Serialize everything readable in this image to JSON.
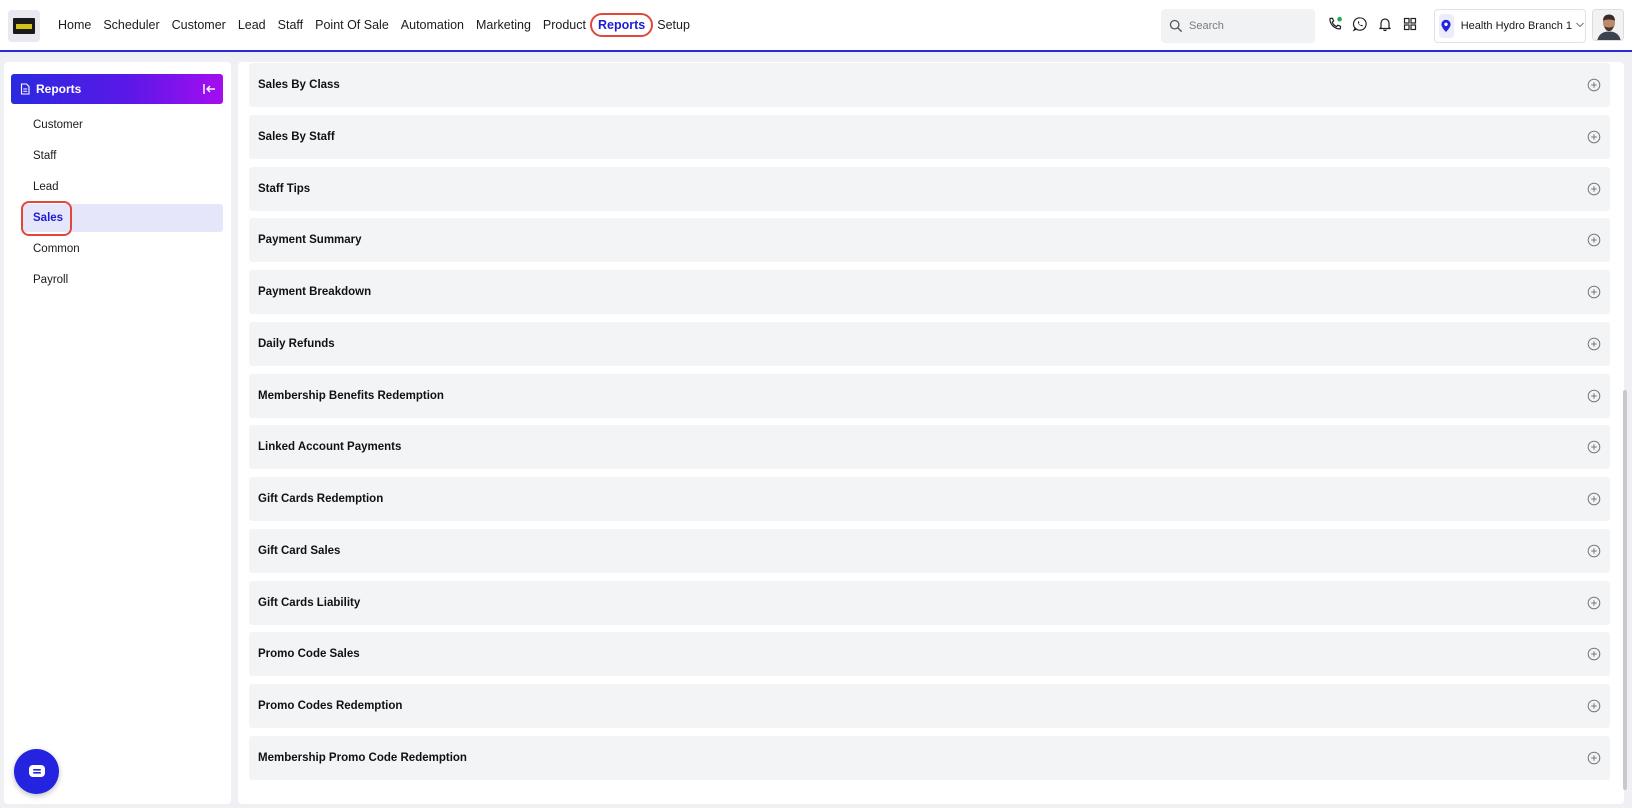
{
  "nav": {
    "items": [
      {
        "label": "Home",
        "name": "nav-home",
        "active": false
      },
      {
        "label": "Scheduler",
        "name": "nav-scheduler",
        "active": false
      },
      {
        "label": "Customer",
        "name": "nav-customer",
        "active": false
      },
      {
        "label": "Lead",
        "name": "nav-lead",
        "active": false
      },
      {
        "label": "Staff",
        "name": "nav-staff",
        "active": false
      },
      {
        "label": "Point Of Sale",
        "name": "nav-point-of-sale",
        "active": false
      },
      {
        "label": "Automation",
        "name": "nav-automation",
        "active": false
      },
      {
        "label": "Marketing",
        "name": "nav-marketing",
        "active": false
      },
      {
        "label": "Product",
        "name": "nav-product",
        "active": false
      },
      {
        "label": "Reports",
        "name": "nav-reports",
        "active": true
      },
      {
        "label": "Setup",
        "name": "nav-setup",
        "active": false
      }
    ]
  },
  "search": {
    "placeholder": "Search"
  },
  "header_icons": [
    "phone-icon",
    "whatsapp-icon",
    "bell-icon",
    "apps-grid-icon"
  ],
  "branch": {
    "label": "Health Hydro Branch 1"
  },
  "sidebar": {
    "title": "Reports",
    "items": [
      {
        "label": "Customer",
        "active": false
      },
      {
        "label": "Staff",
        "active": false
      },
      {
        "label": "Lead",
        "active": false
      },
      {
        "label": "Sales",
        "active": true
      },
      {
        "label": "Common",
        "active": false
      },
      {
        "label": "Payroll",
        "active": false
      }
    ]
  },
  "reports": [
    "Sales By Class",
    "Sales By Staff",
    "Staff Tips",
    "Payment Summary",
    "Payment Breakdown",
    "Daily Refunds",
    "Membership Benefits Redemption",
    "Linked Account Payments",
    "Gift Cards Redemption",
    "Gift Card Sales",
    "Gift Cards Liability",
    "Promo Code Sales",
    "Promo Codes Redemption",
    "Membership Promo Code Redemption"
  ],
  "colors": {
    "accent": "#2323e0",
    "highlight": "#e0483b",
    "active_bg": "#e6e6fb"
  }
}
